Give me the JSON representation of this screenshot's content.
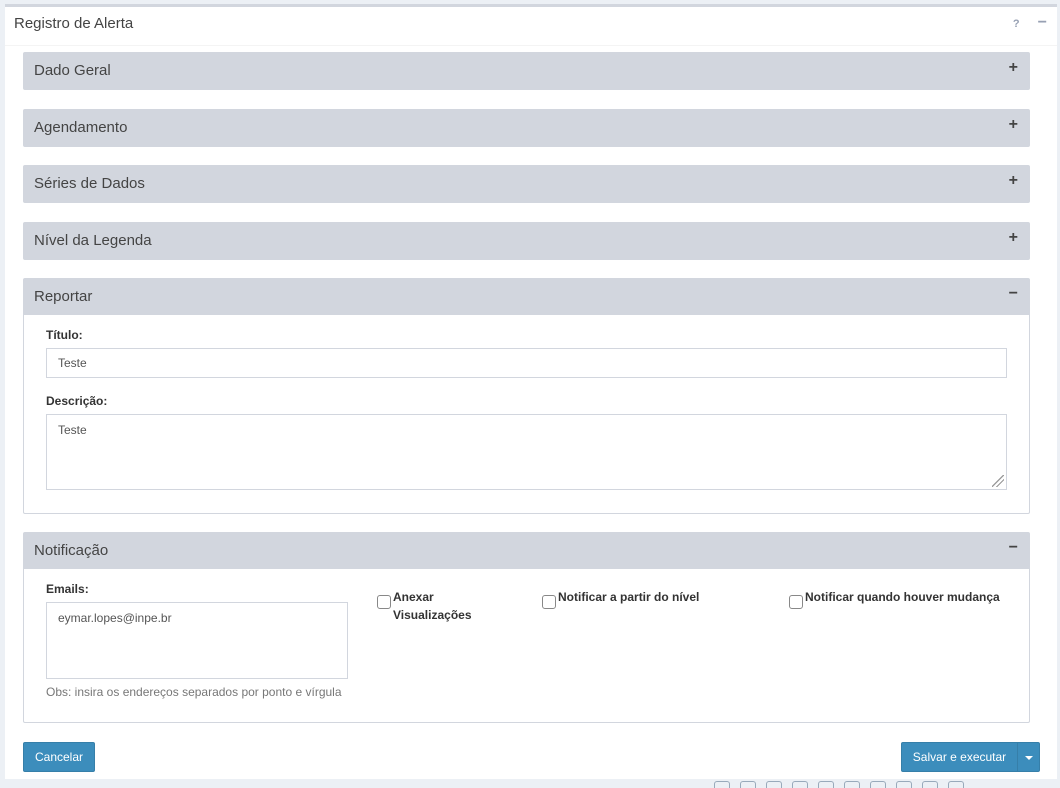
{
  "window": {
    "title": "Registro de Alerta",
    "help_label": "?",
    "minimize_label": "−"
  },
  "sections": [
    {
      "title": "Dado Geral",
      "toggle": "+"
    },
    {
      "title": "Agendamento",
      "toggle": "+"
    },
    {
      "title": "Séries de Dados",
      "toggle": "+"
    },
    {
      "title": "Nível da Legenda",
      "toggle": "+"
    },
    {
      "title": "Reportar",
      "toggle": "−"
    },
    {
      "title": "Notificação",
      "toggle": "−"
    }
  ],
  "report": {
    "title_label": "Título:",
    "title_value": "Teste",
    "description_label": "Descrição:",
    "description_value": "Teste"
  },
  "notification": {
    "emails_label": "Emails:",
    "emails_value": "eymar.lopes@inpe.br",
    "emails_hint": "Obs: insira os endereços separados por ponto e vírgula",
    "attach_label_line1": "Anexar",
    "attach_label_line2": "Visualizações",
    "notify_level_label": "Notificar a partir do nível",
    "notify_change_label": "Notificar quando houver mudança"
  },
  "footer": {
    "cancel_label": "Cancelar",
    "save_label": "Salvar e executar"
  },
  "colors": {
    "primary": "#3c8dbc",
    "panel_header": "#d2d6de",
    "background": "#ecf0f5"
  }
}
